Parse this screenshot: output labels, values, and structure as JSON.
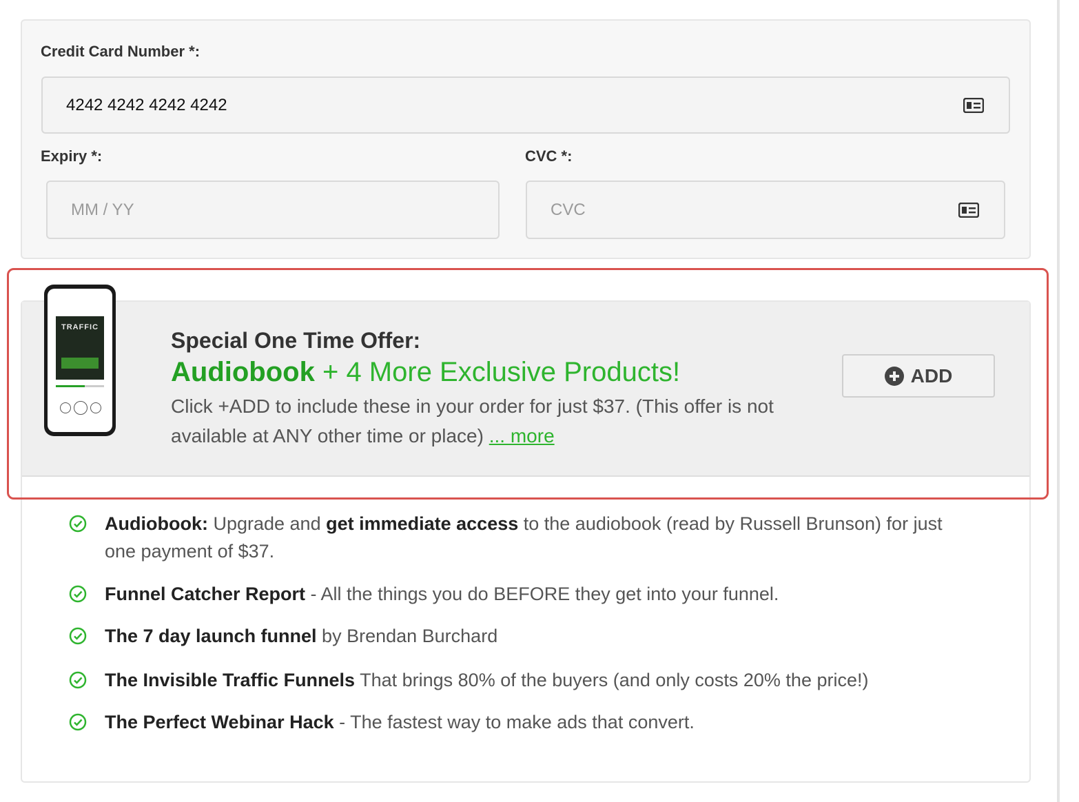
{
  "payment": {
    "card_label": "Credit Card Number *:",
    "card_value": "4242 4242 4242 4242",
    "expiry_label": "Expiry *:",
    "expiry_placeholder": "MM / YY",
    "cvc_label": "CVC *:",
    "cvc_placeholder": "CVC"
  },
  "offer": {
    "title": "Special One Time Offer:",
    "subtitle_bold": "Audiobook",
    "subtitle_rest": " + 4 More Exclusive Products!",
    "description": "Click +ADD to include these in your order for just $37. (This offer is not available at ANY other time or place) ",
    "more_link": "... more",
    "add_button": "ADD",
    "image_book_text": "TRAFFIC",
    "colors": {
      "accent_green": "#2eb42e",
      "highlight_red": "#d9534f"
    }
  },
  "benefits": [
    {
      "bold": "Audiobook:",
      "text_a": " Upgrade and ",
      "bold2": "get immediate access",
      "text_b": " to the audiobook (read by Russell Brunson) for just one payment of $37."
    },
    {
      "bold": "Funnel Catcher Report",
      "text_a": " - All the things you do BEFORE they get into your funnel."
    },
    {
      "bold": "The 7 day launch funnel",
      "text_a": " by Brendan Burchard"
    },
    {
      "bold": "The Invisible Traffic Funnels",
      "text_a": " That brings 80% of the buyers (and only costs 20% the price!)"
    },
    {
      "bold": "The Perfect Webinar Hack",
      "text_a": " - The fastest way to make ads that convert."
    }
  ]
}
